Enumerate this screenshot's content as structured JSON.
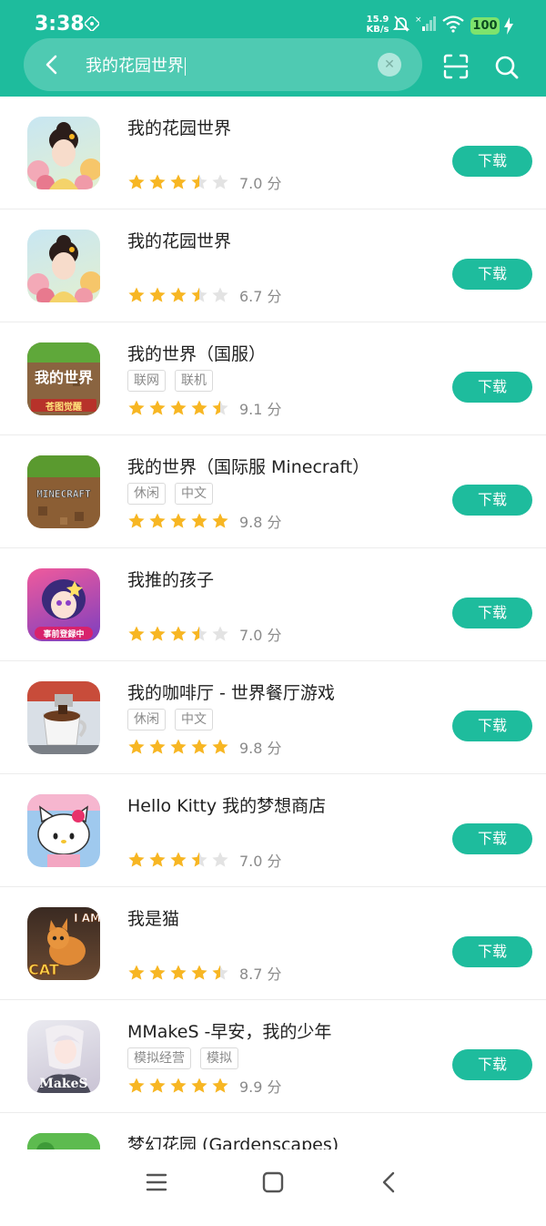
{
  "status_bar": {
    "time": "3:38",
    "net_speed_value": "15.9",
    "net_speed_unit": "KB/s",
    "battery": "100"
  },
  "search": {
    "query": "我的花园世界"
  },
  "download_label": "下载",
  "apps": [
    {
      "name": "我的花园世界",
      "tags": [],
      "stars": 3.5,
      "score": "7.0 分",
      "icon": "garden-world-icon"
    },
    {
      "name": "我的花园世界",
      "tags": [],
      "stars": 3.5,
      "score": "6.7 分",
      "icon": "garden-world-icon"
    },
    {
      "name": "我的世界（国服）",
      "tags": [
        "联网",
        "联机"
      ],
      "stars": 4.5,
      "score": "9.1 分",
      "icon": "minecraft-cn-icon"
    },
    {
      "name": "我的世界（国际服 Minecraft）",
      "tags": [
        "休闲",
        "中文"
      ],
      "stars": 5,
      "score": "9.8 分",
      "icon": "minecraft-icon"
    },
    {
      "name": "我推的孩子",
      "tags": [],
      "stars": 3.5,
      "score": "7.0 分",
      "icon": "oshi-no-ko-icon"
    },
    {
      "name": "我的咖啡厅 - 世界餐厅游戏",
      "tags": [
        "休闲",
        "中文"
      ],
      "stars": 5,
      "score": "9.8 分",
      "icon": "my-cafe-icon"
    },
    {
      "name": "Hello Kitty 我的梦想商店",
      "tags": [],
      "stars": 3.5,
      "score": "7.0 分",
      "icon": "hello-kitty-icon"
    },
    {
      "name": "我是猫",
      "tags": [],
      "stars": 4.5,
      "score": "8.7 分",
      "icon": "i-am-cat-icon"
    },
    {
      "name": "MMakeS -早安，我的少年",
      "tags": [
        "模拟经营",
        "模拟"
      ],
      "stars": 5,
      "score": "9.9 分",
      "icon": "mmakes-icon"
    },
    {
      "name": "梦幻花园 (Gardenscapes)",
      "tags": [],
      "stars": 0,
      "score": "",
      "icon": "gardenscapes-icon"
    }
  ],
  "icon_texts": {
    "minecraft_cn_title": "我的世界",
    "minecraft_cn_sub": "苍图觉醒",
    "minecraft_logo": "MINECRAFT",
    "oshi_badge": "事前登録中",
    "cat_i_am": "I AM",
    "cat_cat": "CAT",
    "mmakes_logo": "MakeS"
  },
  "colors": {
    "accent": "#1ebc9d",
    "star_on": "#f7b623",
    "star_off": "#e3e3e3"
  }
}
